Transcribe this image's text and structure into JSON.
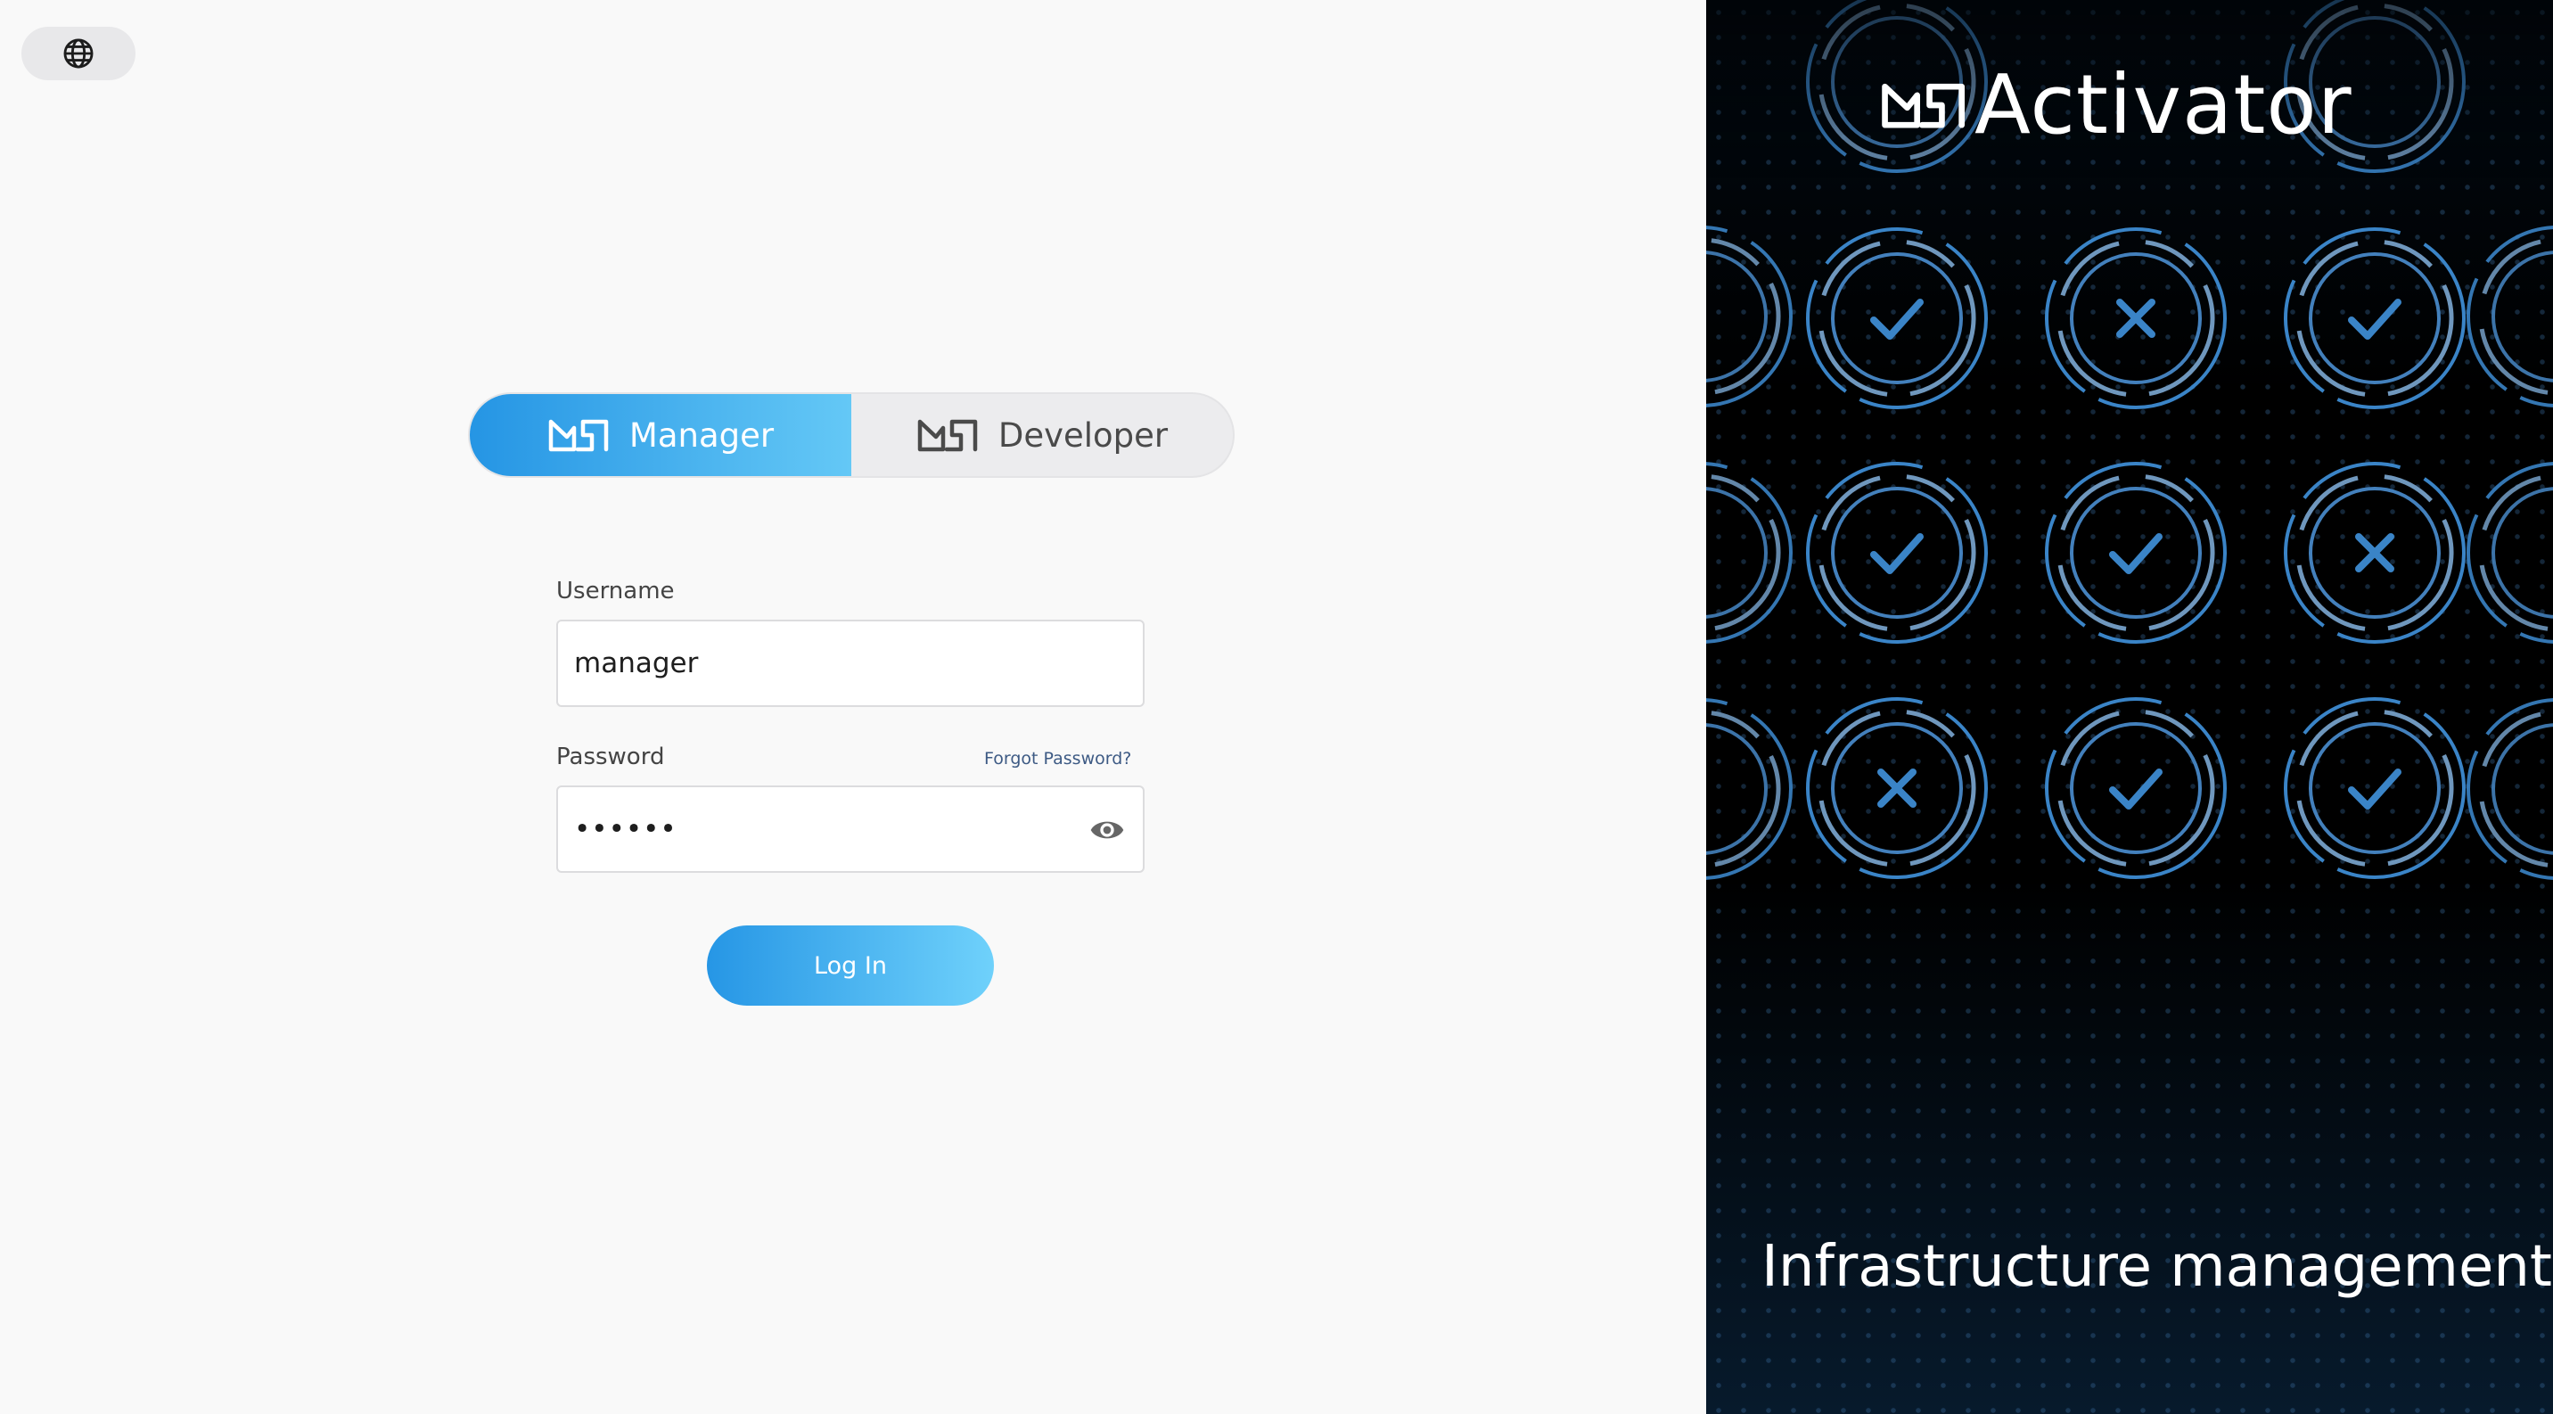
{
  "language": {
    "icon": "globe-icon"
  },
  "roles": [
    {
      "label": "Manager",
      "icon": "msa-logo-icon",
      "active": true
    },
    {
      "label": "Developer",
      "icon": "msa-logo-icon",
      "active": false
    }
  ],
  "form": {
    "username_label": "Username",
    "username_value": "manager",
    "password_label": "Password",
    "password_value": "••••••",
    "forgot_label": "Forgot Password?",
    "toggle_visibility_icon": "eye-icon",
    "login_label": "Log In"
  },
  "promo": {
    "brand": "Activator",
    "brand_icon": "msa-logo-icon",
    "tagline": "Infrastructure management",
    "status_tiles": [
      [
        "check",
        "cross",
        "check"
      ],
      [
        "check",
        "check",
        "cross"
      ],
      [
        "cross",
        "check",
        "check"
      ]
    ]
  },
  "colors": {
    "accent_start": "#2595e4",
    "accent_end": "#64c8f6",
    "panel_dark": "#000000",
    "ring_blue": "#3a84c7"
  }
}
